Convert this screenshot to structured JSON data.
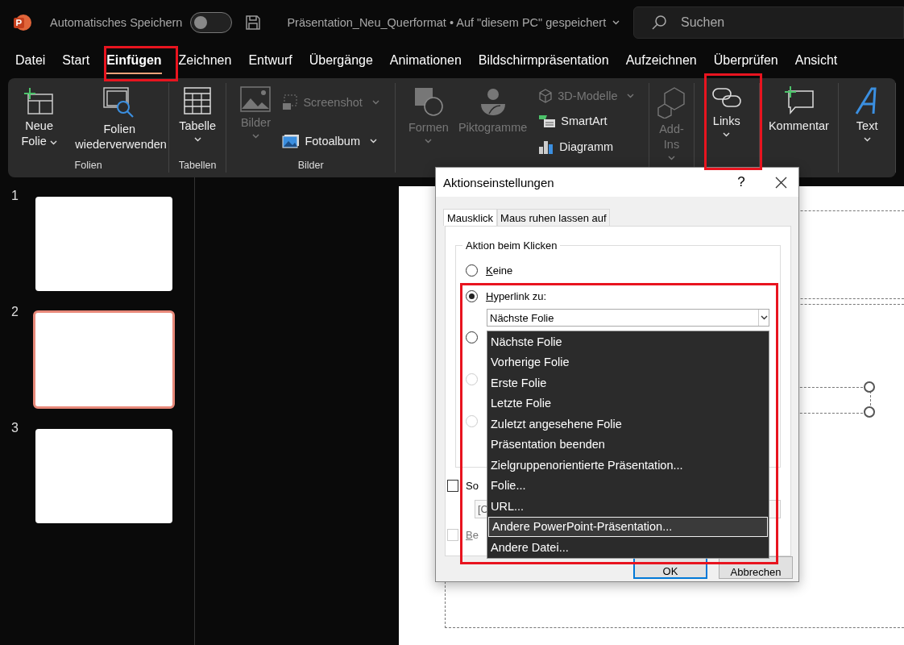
{
  "titlebar": {
    "autosave_label": "Automatisches Speichern",
    "autosave_on": false,
    "document_title": "Präsentation_Neu_Querformat • Auf \"diesem PC\" gespeichert",
    "search_placeholder": "Suchen"
  },
  "tabs": [
    {
      "label": "Datei",
      "selected": false
    },
    {
      "label": "Start",
      "selected": false
    },
    {
      "label": "Einfügen",
      "selected": true
    },
    {
      "label": "Zeichnen",
      "selected": false
    },
    {
      "label": "Entwurf",
      "selected": false
    },
    {
      "label": "Übergänge",
      "selected": false
    },
    {
      "label": "Animationen",
      "selected": false
    },
    {
      "label": "Bildschirmpräsentation",
      "selected": false
    },
    {
      "label": "Aufzeichnen",
      "selected": false
    },
    {
      "label": "Überprüfen",
      "selected": false
    },
    {
      "label": "Ansicht",
      "selected": false
    }
  ],
  "ribbon": {
    "groups": [
      {
        "label": "Folien",
        "commands": [
          {
            "kind": "large",
            "label": "Neue Folie",
            "dropdown": true,
            "disabled": false
          },
          {
            "kind": "large",
            "label": "Folien wiederverwenden",
            "dropdown": false,
            "disabled": false
          }
        ]
      },
      {
        "label": "Tabellen",
        "commands": [
          {
            "kind": "large",
            "label": "Tabelle",
            "dropdown": true,
            "disabled": false
          }
        ]
      },
      {
        "label": "Bilder",
        "commands": [
          {
            "kind": "large",
            "label": "Bilder",
            "dropdown": true,
            "disabled": true
          },
          {
            "kind": "small",
            "label": "Screenshot",
            "dropdown": true,
            "disabled": true
          },
          {
            "kind": "small",
            "label": "Fotoalbum",
            "dropdown": true,
            "disabled": false
          }
        ]
      },
      {
        "commands": [
          {
            "kind": "large",
            "label": "Formen",
            "dropdown": true,
            "disabled": true
          },
          {
            "kind": "large",
            "label": "Piktogramme",
            "dropdown": false,
            "disabled": true
          },
          {
            "kind": "small",
            "label": "3D-Modelle",
            "dropdown": true,
            "disabled": true
          },
          {
            "kind": "small",
            "label": "SmartArt",
            "dropdown": false,
            "disabled": false
          },
          {
            "kind": "small",
            "label": "Diagramm",
            "dropdown": false,
            "disabled": false
          }
        ]
      },
      {
        "commands": [
          {
            "kind": "large",
            "label": "Add-Ins",
            "dropdown": true,
            "disabled": true
          }
        ]
      },
      {
        "commands": [
          {
            "kind": "large",
            "label": "Links",
            "dropdown": true,
            "disabled": false
          }
        ]
      },
      {
        "commands": [
          {
            "kind": "large",
            "label": "Kommentar",
            "dropdown": false,
            "disabled": false
          }
        ]
      },
      {
        "commands": [
          {
            "kind": "large",
            "label": "Text",
            "dropdown": true,
            "disabled": false
          }
        ]
      }
    ]
  },
  "slides": [
    {
      "number": "1",
      "selected": false
    },
    {
      "number": "2",
      "selected": true
    },
    {
      "number": "3",
      "selected": false
    }
  ],
  "dialog": {
    "title": "Aktionseinstellungen",
    "help": "?",
    "tabs": [
      {
        "label": "Mausklick",
        "selected": true
      },
      {
        "label": "Maus ruhen lassen auf",
        "selected": false
      }
    ],
    "group_title": "Aktion beim Klicken",
    "options": [
      {
        "label": "Keine",
        "selected": false,
        "disabled": false
      },
      {
        "label": "Hyperlink zu:",
        "selected": true,
        "disabled": false
      },
      {
        "selected": false,
        "disabled": false
      },
      {
        "selected": false,
        "disabled": true
      },
      {
        "selected": false,
        "disabled": true
      }
    ],
    "combo_value": "Nächste Folie",
    "dropdown_items": [
      {
        "label": "Nächste Folie",
        "selected": false
      },
      {
        "label": "Vorherige Folie",
        "selected": false
      },
      {
        "label": "Erste Folie",
        "selected": false
      },
      {
        "label": "Letzte Folie",
        "selected": false
      },
      {
        "label": "Zuletzt angesehene Folie",
        "selected": false
      },
      {
        "label": "Präsentation beenden",
        "selected": false
      },
      {
        "label": "Zielgruppenorientierte Präsentation...",
        "selected": false
      },
      {
        "label": "Folie...",
        "selected": false
      },
      {
        "label": "URL...",
        "selected": false
      },
      {
        "label": "Andere PowerPoint-Präsentation...",
        "selected": true
      },
      {
        "label": "Andere Datei...",
        "selected": false
      }
    ],
    "sound_checkbox": {
      "label": "So",
      "checked": false,
      "disabled": false
    },
    "sound_field": "[C",
    "highlight_checkbox": {
      "label": "Be",
      "checked": false,
      "disabled": true
    },
    "buttons": [
      {
        "label": "OK",
        "default": true
      },
      {
        "label": "Abbrechen",
        "default": false
      }
    ]
  }
}
